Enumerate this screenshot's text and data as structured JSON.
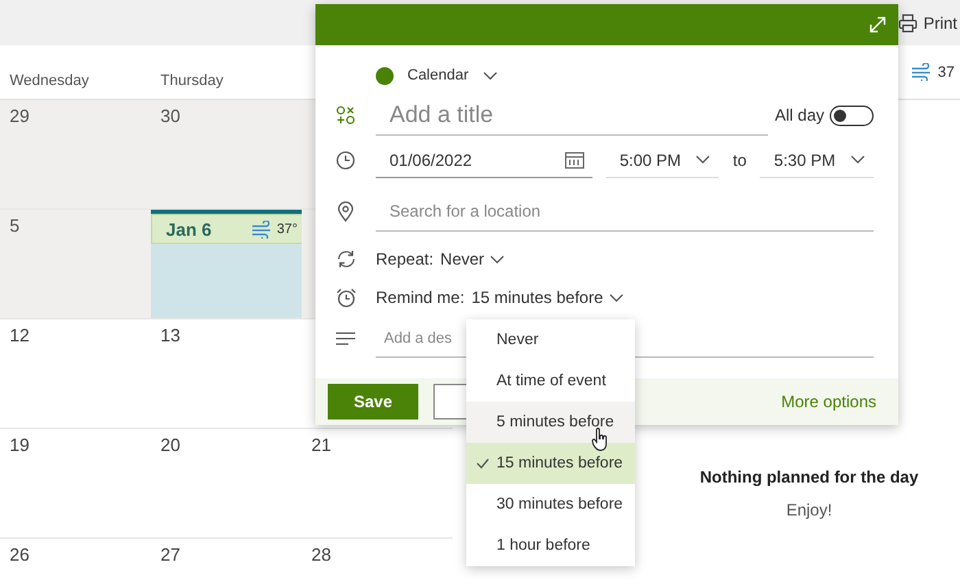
{
  "toolbar": {
    "print": "Print"
  },
  "calendar": {
    "days": [
      "Wednesday",
      "Thursday"
    ],
    "weeks": [
      {
        "past": true,
        "cells": [
          {
            "date": "29",
            "selected": false
          },
          {
            "date": "30",
            "selected": false
          }
        ]
      },
      {
        "past": true,
        "cells": [
          {
            "date": "5",
            "selected": false
          },
          {
            "date": "Jan 6",
            "selected": true,
            "temperature": "37°"
          }
        ]
      },
      {
        "past": false,
        "cells": [
          {
            "date": "12",
            "selected": false
          },
          {
            "date": "13",
            "selected": false
          }
        ]
      },
      {
        "past": false,
        "cells": [
          {
            "date": "19",
            "selected": false
          },
          {
            "date": "20",
            "selected": false
          },
          {
            "date": "21",
            "selected": false
          }
        ]
      },
      {
        "past": false,
        "cells": [
          {
            "date": "26",
            "selected": false
          },
          {
            "date": "27",
            "selected": false
          },
          {
            "date": "28",
            "selected": false
          }
        ]
      }
    ]
  },
  "day_pane": {
    "temperature": "37",
    "empty_title": "Nothing planned for the day",
    "empty_subtitle": "Enjoy!"
  },
  "event_form": {
    "calendar": "Calendar",
    "title": {
      "placeholder": "Add a title"
    },
    "all_day": {
      "label": "All day",
      "on": false
    },
    "date": "01/06/2022",
    "start": "5:00 PM",
    "to": "to",
    "end": "5:30 PM",
    "location": {
      "placeholder": "Search for a location"
    },
    "repeat": {
      "label": "Repeat:",
      "value": "Never"
    },
    "remind": {
      "label": "Remind me:",
      "value": "15 minutes before"
    },
    "description": {
      "placeholder": "Add a des"
    },
    "save": "Save",
    "more_options": "More options"
  },
  "reminder_menu": [
    {
      "label": "Never",
      "selected": false,
      "hovered": false
    },
    {
      "label": "At time of event",
      "selected": false,
      "hovered": false
    },
    {
      "label": "5 minutes before",
      "selected": false,
      "hovered": true
    },
    {
      "label": "15 minutes before",
      "selected": true,
      "hovered": false
    },
    {
      "label": "30 minutes before",
      "selected": false,
      "hovered": false
    },
    {
      "label": "1 hour before",
      "selected": false,
      "hovered": false
    }
  ]
}
